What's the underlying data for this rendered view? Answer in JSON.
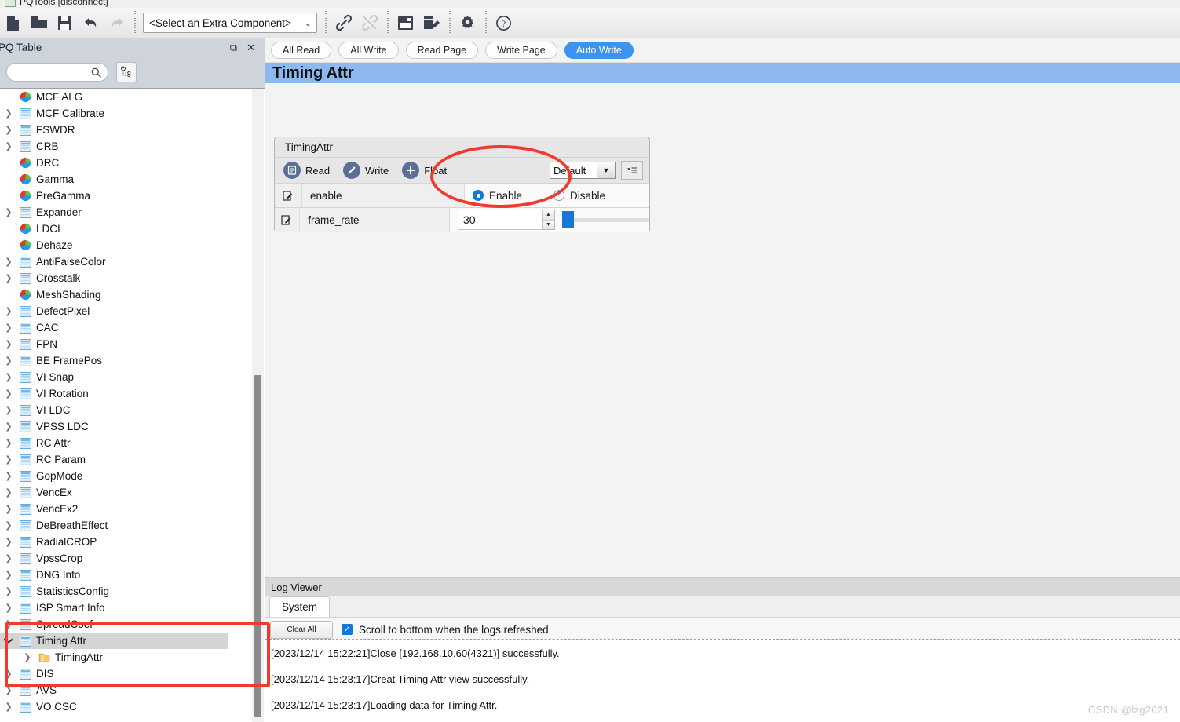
{
  "window": {
    "title": "PQTools  [disconnect]",
    "icon": "app-icon"
  },
  "toolbar": {
    "buttons": [
      {
        "name": "new-file-icon",
        "label": "New"
      },
      {
        "name": "open-folder-icon",
        "label": "Open"
      },
      {
        "name": "save-icon",
        "label": "Save"
      },
      {
        "name": "undo-icon",
        "label": "Undo"
      },
      {
        "name": "redo-icon",
        "label": "Redo"
      }
    ],
    "component_select": {
      "value": "<Select an Extra Component>",
      "chevron": "chevron-down-icon"
    },
    "buttons2": [
      {
        "name": "link-icon",
        "label": "Connect"
      },
      {
        "name": "broken-link-icon",
        "label": "Disconnect"
      },
      {
        "name": "save-config-icon",
        "label": "Save Config"
      },
      {
        "name": "edit-script-icon",
        "label": "Edit Script"
      },
      {
        "name": "gear-icon",
        "label": "Settings"
      },
      {
        "name": "help-icon",
        "label": "Help"
      }
    ]
  },
  "left_panel": {
    "title": "PQ Table",
    "float_button": "float-icon",
    "close_button": "close-icon",
    "search": {
      "value": "",
      "placeholder": ""
    },
    "filter_button": "filter-tree-icon",
    "tree": [
      {
        "label": "MCF ALG",
        "icon": "pie-icon",
        "twisty": "none",
        "depth": 1
      },
      {
        "label": "MCF Calibrate",
        "icon": "table-icon",
        "twisty": "closed",
        "depth": 1
      },
      {
        "label": "FSWDR",
        "icon": "table-icon",
        "twisty": "closed",
        "depth": 1
      },
      {
        "label": "CRB",
        "icon": "table-icon",
        "twisty": "closed",
        "depth": 1
      },
      {
        "label": "DRC",
        "icon": "pie-icon",
        "twisty": "none",
        "depth": 1
      },
      {
        "label": "Gamma",
        "icon": "pie-icon",
        "twisty": "none",
        "depth": 1
      },
      {
        "label": "PreGamma",
        "icon": "pie-icon",
        "twisty": "none",
        "depth": 1
      },
      {
        "label": "Expander",
        "icon": "table-icon",
        "twisty": "closed",
        "depth": 1
      },
      {
        "label": "LDCI",
        "icon": "pie-icon",
        "twisty": "none",
        "depth": 1
      },
      {
        "label": "Dehaze",
        "icon": "pie-icon",
        "twisty": "none",
        "depth": 1
      },
      {
        "label": "AntiFalseColor",
        "icon": "table-icon",
        "twisty": "closed",
        "depth": 1
      },
      {
        "label": "Crosstalk",
        "icon": "table-icon",
        "twisty": "closed",
        "depth": 1
      },
      {
        "label": "MeshShading",
        "icon": "pie-icon",
        "twisty": "none",
        "depth": 1
      },
      {
        "label": "DefectPixel",
        "icon": "table-icon",
        "twisty": "closed",
        "depth": 1
      },
      {
        "label": "CAC",
        "icon": "table-icon",
        "twisty": "closed",
        "depth": 1
      },
      {
        "label": "FPN",
        "icon": "table-icon",
        "twisty": "closed",
        "depth": 1
      },
      {
        "label": "BE FramePos",
        "icon": "table-icon",
        "twisty": "closed",
        "depth": 1
      },
      {
        "label": "VI Snap",
        "icon": "table-icon",
        "twisty": "closed",
        "depth": 1
      },
      {
        "label": "VI Rotation",
        "icon": "table-icon",
        "twisty": "closed",
        "depth": 1
      },
      {
        "label": "VI LDC",
        "icon": "table-icon",
        "twisty": "closed",
        "depth": 1
      },
      {
        "label": "VPSS LDC",
        "icon": "table-icon",
        "twisty": "closed",
        "depth": 1
      },
      {
        "label": "RC Attr",
        "icon": "table-icon",
        "twisty": "closed",
        "depth": 1
      },
      {
        "label": "RC Param",
        "icon": "table-icon",
        "twisty": "closed",
        "depth": 1
      },
      {
        "label": "GopMode",
        "icon": "table-icon",
        "twisty": "closed",
        "depth": 1
      },
      {
        "label": "VencEx",
        "icon": "table-icon",
        "twisty": "closed",
        "depth": 1
      },
      {
        "label": "VencEx2",
        "icon": "table-icon",
        "twisty": "closed",
        "depth": 1
      },
      {
        "label": "DeBreathEffect",
        "icon": "table-icon",
        "twisty": "closed",
        "depth": 1
      },
      {
        "label": "RadialCROP",
        "icon": "table-icon",
        "twisty": "closed",
        "depth": 1
      },
      {
        "label": "VpssCrop",
        "icon": "table-icon",
        "twisty": "closed",
        "depth": 1
      },
      {
        "label": "DNG Info",
        "icon": "table-icon",
        "twisty": "closed",
        "depth": 1
      },
      {
        "label": "StatisticsConfig",
        "icon": "table-icon",
        "twisty": "closed",
        "depth": 1
      },
      {
        "label": "ISP Smart Info",
        "icon": "table-icon",
        "twisty": "closed",
        "depth": 1
      },
      {
        "label": "SpreadCoef",
        "icon": "table-icon",
        "twisty": "closed",
        "depth": 1
      },
      {
        "label": "Timing Attr",
        "icon": "table-icon",
        "twisty": "open",
        "depth": 1,
        "selected": true
      },
      {
        "label": "TimingAttr",
        "icon": "folder-icon",
        "twisty": "closed",
        "depth": 2
      },
      {
        "label": "DIS",
        "icon": "table-icon",
        "twisty": "closed",
        "depth": 1
      },
      {
        "label": "AVS",
        "icon": "table-icon",
        "twisty": "closed",
        "depth": 1
      },
      {
        "label": "VO CSC",
        "icon": "table-icon",
        "twisty": "closed",
        "depth": 1
      }
    ]
  },
  "main": {
    "action_pills": [
      {
        "label": "All Read",
        "active": false
      },
      {
        "label": "All Write",
        "active": false
      },
      {
        "label": "Read Page",
        "active": false
      },
      {
        "label": "Write Page",
        "active": false
      },
      {
        "label": "Auto Write",
        "active": true
      }
    ],
    "page_title": "Timing Attr",
    "group": {
      "title": "TimingAttr",
      "actions": [
        {
          "label": "Read",
          "icon": "read-icon"
        },
        {
          "label": "Write",
          "icon": "write-pencil-icon"
        },
        {
          "label": "Float",
          "icon": "plus-icon"
        }
      ],
      "preset": {
        "value": "Default",
        "chevron": "chevron-down-icon"
      },
      "more_button": "preset-menu-icon",
      "rows": [
        {
          "name": "enable",
          "edit_icon": "edit-pencil-icon",
          "type": "radio",
          "options": [
            {
              "label": "Enable",
              "selected": true
            },
            {
              "label": "Disable",
              "selected": false
            }
          ]
        },
        {
          "name": "frame_rate",
          "edit_icon": "edit-pencil-icon",
          "type": "number",
          "value": "30",
          "slider_percent": 6
        }
      ]
    }
  },
  "log_viewer": {
    "title": "Log Viewer",
    "tabs": [
      {
        "label": "System",
        "active": true
      }
    ],
    "clear_button": "Clear All",
    "scroll_checkbox": {
      "label": "Scroll to bottom when the logs refreshed",
      "checked": true,
      "mark": "✓"
    },
    "lines": [
      "[2023/12/14 15:22:21]Close [192.168.10.60(4321)] successfully.",
      "[2023/12/14 15:23:17]Creat Timing Attr view successfully.",
      "[2023/12/14 15:23:17]Loading data for Timing Attr."
    ]
  },
  "annotations": {
    "highlight_color": "#ef3a2d",
    "rect_target": "timing-attr-tree-node",
    "ellipse_target": "enable-value-cell"
  },
  "watermark": "CSDN @lzg2021"
}
